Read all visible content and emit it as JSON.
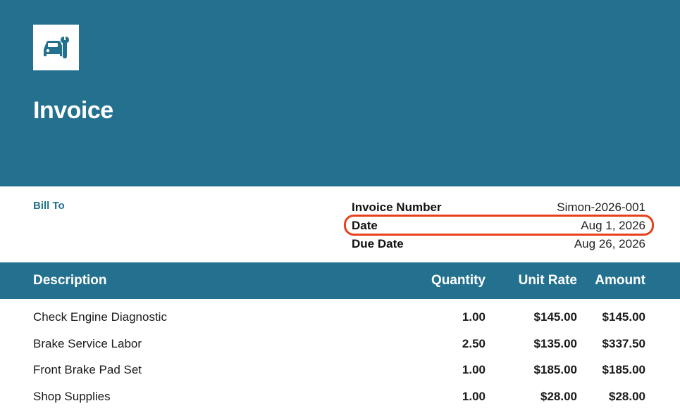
{
  "header": {
    "title": "Invoice",
    "logo_icon": "car-wrench-icon",
    "background_color": "#24718f"
  },
  "bill_to": {
    "label": "Bill To"
  },
  "meta": [
    {
      "label": "Invoice Number",
      "value": "Simon-2026-001"
    },
    {
      "label": "Date",
      "value": "Aug 1, 2026"
    },
    {
      "label": "Due Date",
      "value": "Aug 26, 2026"
    }
  ],
  "highlight_color": "#e8401c",
  "table": {
    "headers": {
      "description": "Description",
      "quantity": "Quantity",
      "unit_rate": "Unit Rate",
      "amount": "Amount"
    },
    "rows": [
      {
        "description": "Check Engine Diagnostic",
        "quantity": "1.00",
        "unit_rate": "$145.00",
        "amount": "$145.00"
      },
      {
        "description": "Brake Service Labor",
        "quantity": "2.50",
        "unit_rate": "$135.00",
        "amount": "$337.50"
      },
      {
        "description": "Front Brake Pad Set",
        "quantity": "1.00",
        "unit_rate": "$185.00",
        "amount": "$185.00"
      },
      {
        "description": "Shop Supplies",
        "quantity": "1.00",
        "unit_rate": "$28.00",
        "amount": "$28.00"
      }
    ]
  }
}
